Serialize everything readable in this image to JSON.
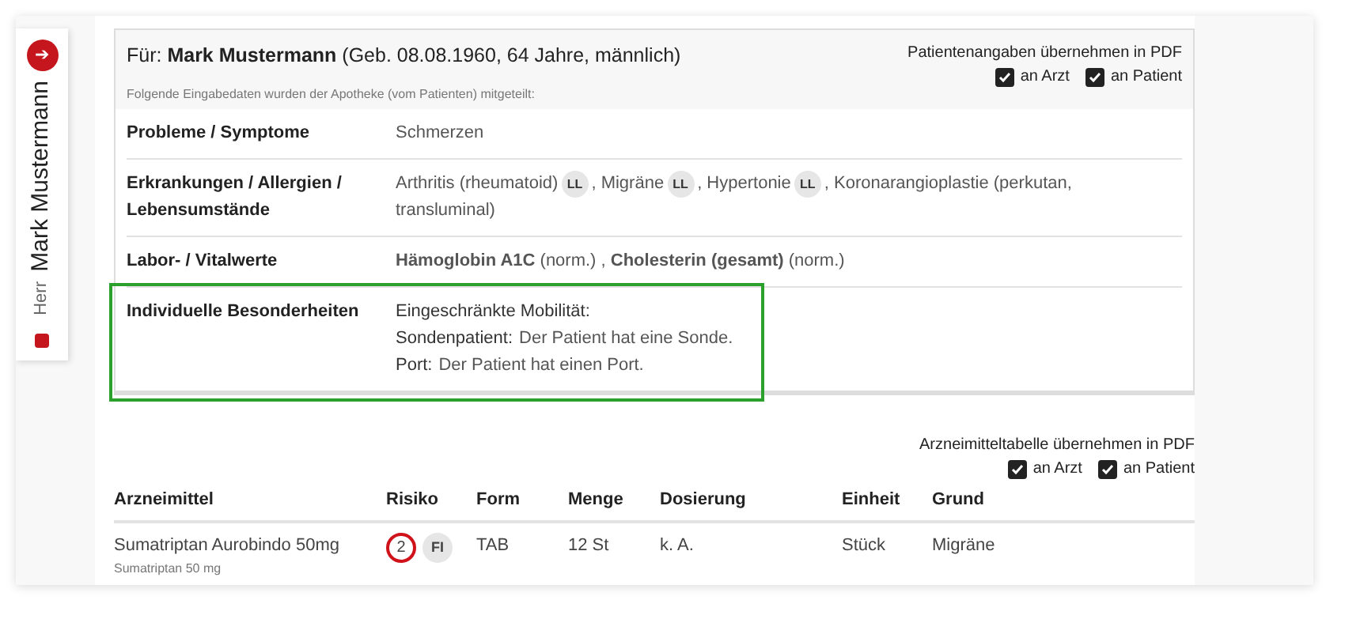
{
  "sidebar": {
    "action": "➔",
    "salutation": "Herr",
    "name": "Mark Mustermann"
  },
  "patient": {
    "prefix": "Für:",
    "name": "Mark Mustermann",
    "details": "(Geb. 08.08.1960, 64 Jahre, männlich)",
    "note": "Folgende Eingabedaten wurden der Apotheke (vom Patienten) mitgeteilt:",
    "pdf": {
      "label": "Patientenangaben übernehmen in PDF",
      "options": [
        {
          "label": "an Arzt",
          "checked": true
        },
        {
          "label": "an Patient",
          "checked": true
        }
      ]
    }
  },
  "rows": [
    {
      "label": "Probleme / Symptome",
      "highlighted": false,
      "lines": [
        [
          {
            "kind": "text",
            "text": "Schmerzen"
          }
        ]
      ]
    },
    {
      "label": "Erkrankungen / Allergien / Lebensumstände",
      "highlighted": false,
      "lines": [
        [
          {
            "kind": "text",
            "text": "Arthritis (rheumatoid)"
          },
          {
            "kind": "badge",
            "text": "LL"
          },
          {
            "kind": "text",
            "text": ", Migräne"
          },
          {
            "kind": "badge",
            "text": "LL"
          },
          {
            "kind": "text",
            "text": ", Hypertonie"
          },
          {
            "kind": "badge",
            "text": "LL"
          },
          {
            "kind": "text",
            "text": ", Koronarangioplastie (perkutan,"
          }
        ],
        [
          {
            "kind": "text",
            "text": "transluminal)"
          }
        ]
      ]
    },
    {
      "label": "Labor- / Vitalwerte",
      "highlighted": false,
      "lines": [
        [
          {
            "kind": "text",
            "text": "**Hämoglobin A1C** (norm.) , **Cholesterin (gesamt)** (norm.)"
          }
        ]
      ]
    },
    {
      "label": "Individuelle Besonderheiten",
      "highlighted": true,
      "lines": [
        [
          {
            "kind": "key",
            "text": "Eingeschränkte Mobilität:"
          }
        ],
        [
          {
            "kind": "key",
            "text": "Sondenpatient:"
          },
          {
            "kind": "text",
            "text": "Der Patient hat eine Sonde."
          }
        ],
        [
          {
            "kind": "key",
            "text": "Port:"
          },
          {
            "kind": "text",
            "text": "Der Patient hat einen Port."
          }
        ]
      ]
    }
  ],
  "medication": {
    "pdf": {
      "label": "Arzneimitteltabelle übernehmen in PDF",
      "options": [
        {
          "label": "an Arzt",
          "checked": true
        },
        {
          "label": "an Patient",
          "checked": true
        }
      ]
    },
    "columns": [
      "Arzneimittel",
      "Risiko",
      "Form",
      "Menge",
      "Dosierung",
      "Einheit",
      "Grund"
    ],
    "rows": [
      {
        "name": "Sumatriptan Aurobindo 50mg",
        "substance": "Sumatriptan 50 mg",
        "risk": [
          {
            "kind": "circled",
            "text": "2"
          },
          {
            "kind": "pill",
            "text": "FI"
          }
        ],
        "form": "TAB",
        "amount": "12 St",
        "dosage": "k. A.",
        "unit": "Stück",
        "reason": "Migräne"
      }
    ]
  }
}
